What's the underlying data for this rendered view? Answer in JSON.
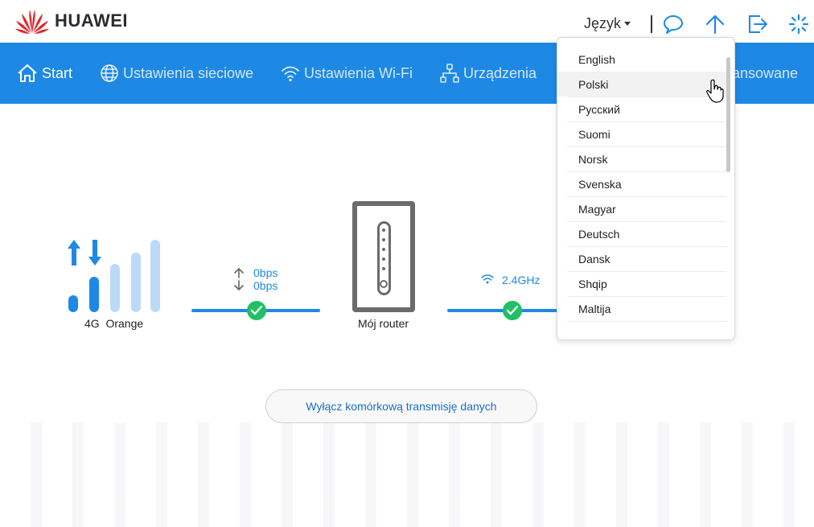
{
  "header": {
    "logo_text": "HUAWEI",
    "language_label": "Język",
    "icons": [
      "chat-icon",
      "upload-icon",
      "logout-icon",
      "loading-icon"
    ]
  },
  "nav": {
    "items": [
      {
        "label": "Start",
        "icon": "home-icon"
      },
      {
        "label": "Ustawienia sieciowe",
        "icon": "globe-icon"
      },
      {
        "label": "Ustawienia Wi-Fi",
        "icon": "wifi-icon"
      },
      {
        "label": "Urządzenia",
        "icon": "devices-icon"
      },
      {
        "label": "ansowane",
        "icon": ""
      }
    ]
  },
  "status": {
    "network_type": "4G",
    "operator": "Orange",
    "upload_rate": "0bps",
    "download_rate": "0bps",
    "router_label": "Mój router",
    "wifi_band": "2.4GHz",
    "action_button": "Wyłącz komórkową transmisję danych"
  },
  "language_menu": {
    "items": [
      "English",
      "Polski",
      "Русский",
      "Suomi",
      "Norsk",
      "Svenska",
      "Magyar",
      "Deutsch",
      "Dansk",
      "Shqip",
      "Maltija"
    ],
    "hovered": "Polski"
  },
  "colors": {
    "accent": "#1e88e5",
    "ok": "#21c064",
    "huawei_red": "#e3242b"
  }
}
